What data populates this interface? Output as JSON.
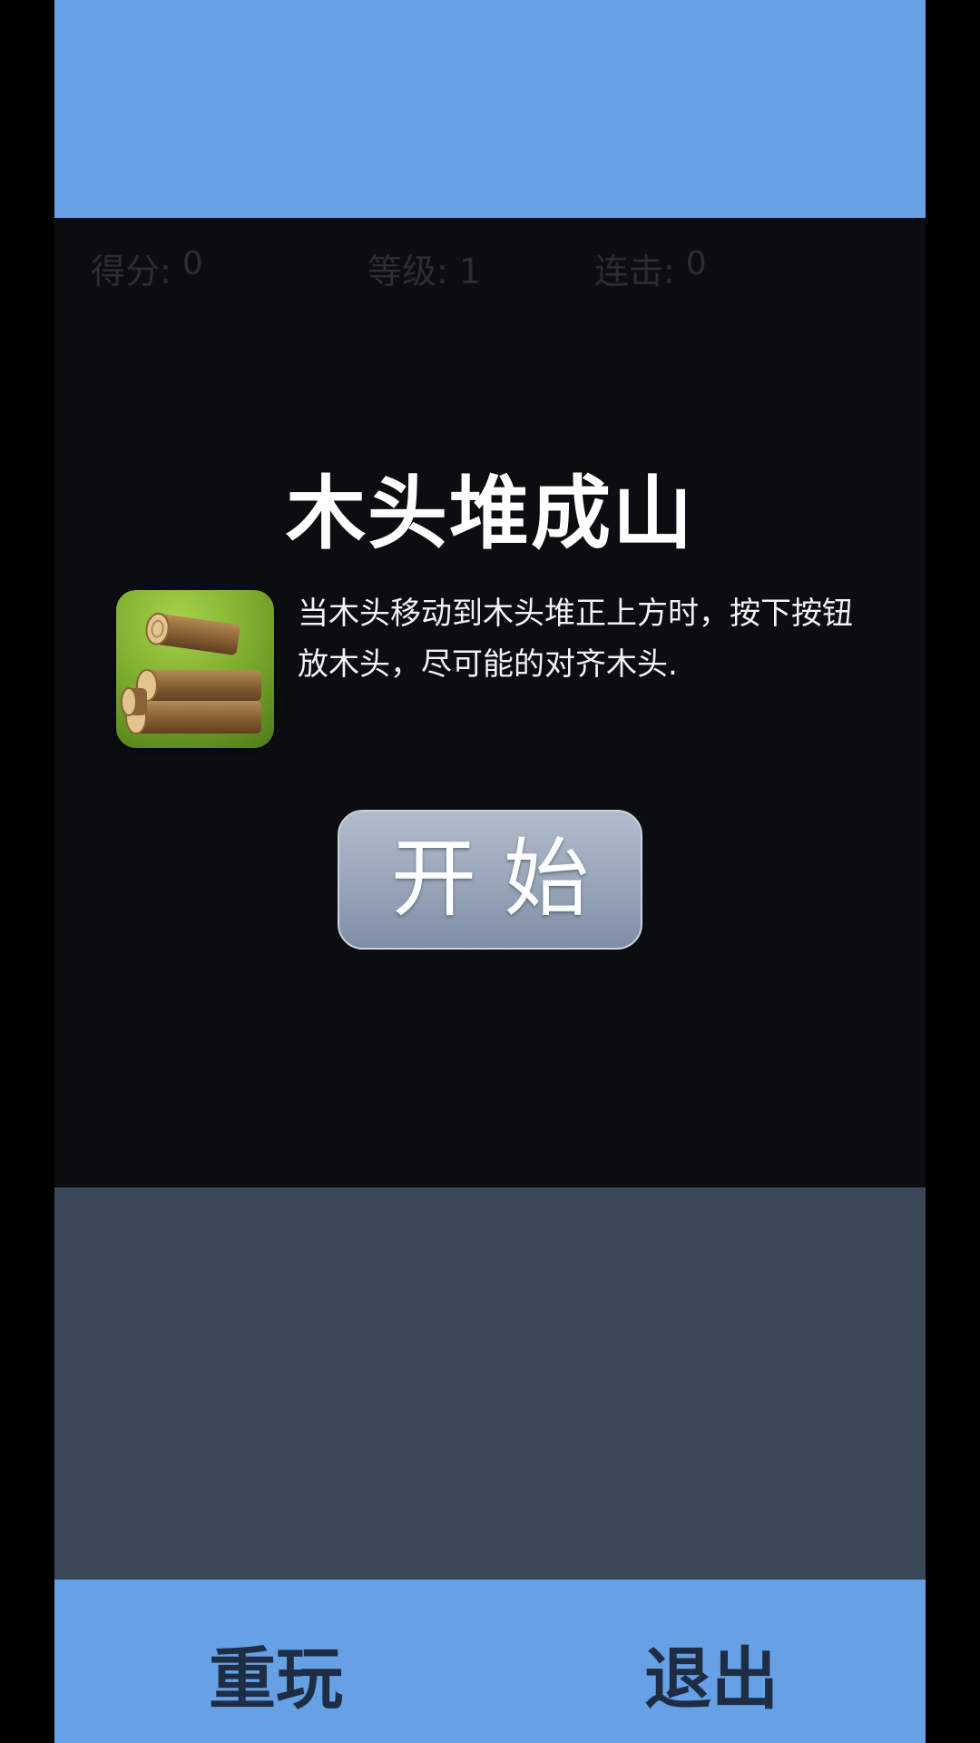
{
  "stats": {
    "score_label": "得分:",
    "score_value": "0",
    "level_label": "等级:",
    "level_value": "1",
    "combo_label": "连击:",
    "combo_value": "0"
  },
  "dialog": {
    "title": "木头堆成山",
    "description": "当木头移动到木头堆正上方时，按下按钮放木头，尽可能的对齐木头.",
    "icon": "log-pile-icon",
    "start_label": "开始"
  },
  "bottom_bar": {
    "replay_label": "重玩",
    "exit_label": "退出"
  },
  "colors": {
    "top_band": "#66a1e6",
    "game_area": "#0c0d11",
    "panel": "#3b4758",
    "bottom_bar": "#66a1e6",
    "bottom_text": "#1f2d44"
  }
}
